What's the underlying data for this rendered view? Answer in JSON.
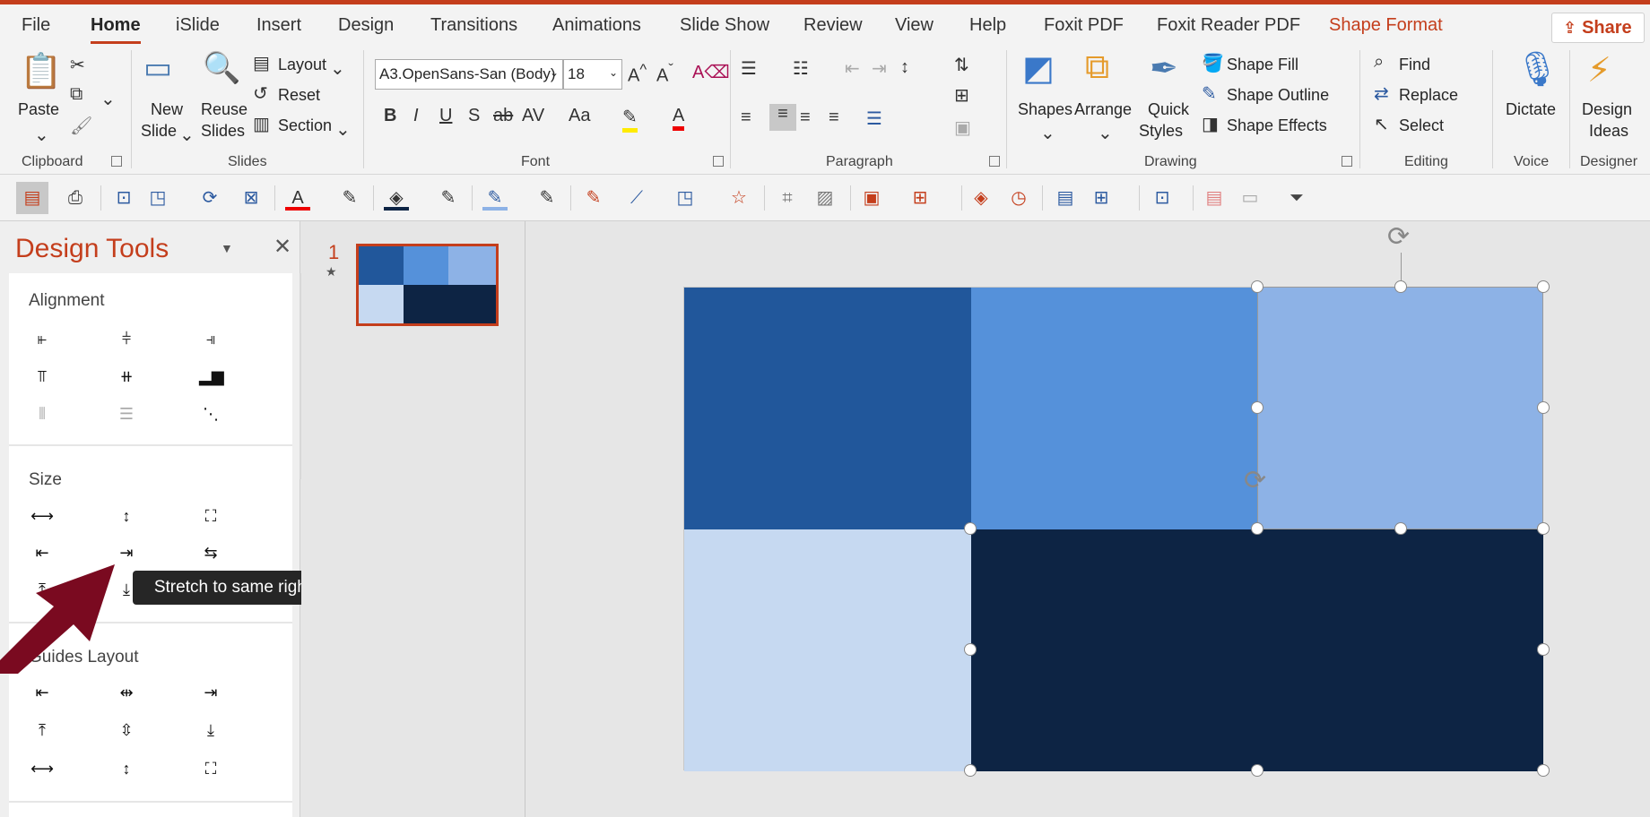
{
  "colors": {
    "accent": "#c43e1c",
    "dark_blue": "#21579b",
    "mid_blue": "#5591da",
    "light_blue": "#8db2e6",
    "pale_blue": "#c6d9f1",
    "navy": "#0d2444"
  },
  "tabs": [
    "File",
    "Home",
    "iSlide",
    "Insert",
    "Design",
    "Transitions",
    "Animations",
    "Slide Show",
    "Review",
    "View",
    "Help",
    "Foxit PDF",
    "Foxit Reader PDF",
    "Shape Format"
  ],
  "active_tab": "Home",
  "share_label": "Share",
  "ribbon": {
    "clipboard": {
      "label": "Clipboard",
      "paste": "Paste"
    },
    "slides": {
      "label": "Slides",
      "new_slide_1": "New",
      "new_slide_2": "Slide",
      "reuse_1": "Reuse",
      "reuse_2": "Slides",
      "layout": "Layout",
      "reset": "Reset",
      "section": "Section"
    },
    "font": {
      "label": "Font",
      "font_name": "A3.OpenSans-San (Body)",
      "font_size": "18"
    },
    "paragraph": {
      "label": "Paragraph"
    },
    "drawing": {
      "label": "Drawing",
      "shapes": "Shapes",
      "arrange": "Arrange",
      "quick_1": "Quick",
      "quick_2": "Styles",
      "shape_fill": "Shape Fill",
      "shape_outline": "Shape Outline",
      "shape_effects": "Shape Effects"
    },
    "editing": {
      "label": "Editing",
      "find": "Find",
      "replace": "Replace",
      "select": "Select"
    },
    "voice": {
      "label": "Voice",
      "dictate": "Dictate"
    },
    "designer": {
      "label": "Designer",
      "ideas_1": "Design",
      "ideas_2": "Ideas"
    }
  },
  "design_tools": {
    "title": "Design Tools",
    "alignment": "Alignment",
    "size": "Size",
    "guides_layout": "Guides Layout",
    "tooltip": "Stretch to same right"
  },
  "thumbnails": {
    "slide_number": "1"
  }
}
